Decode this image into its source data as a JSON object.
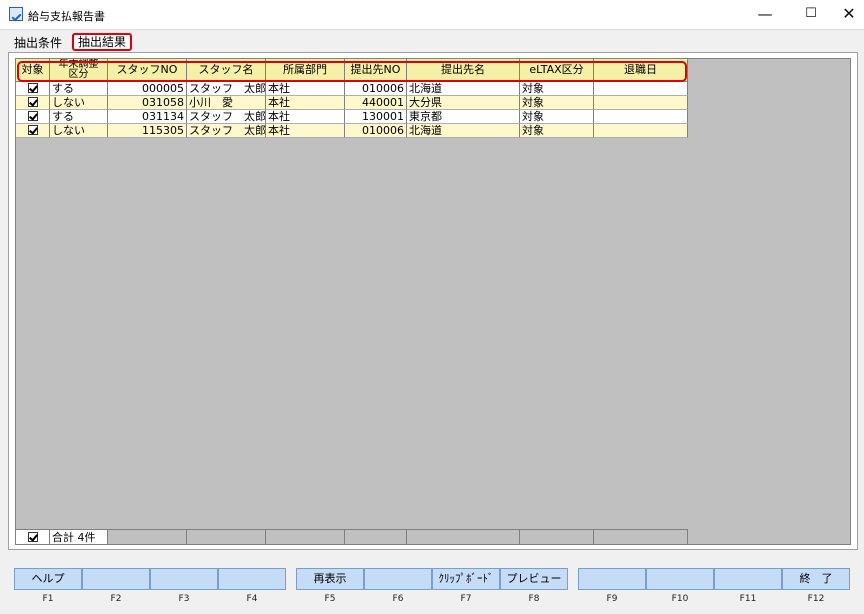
{
  "window": {
    "title": "給与支払報告書",
    "min": "—",
    "max": "☐",
    "close": "✕"
  },
  "tabs": [
    {
      "label": "抽出条件"
    },
    {
      "label": "抽出結果"
    }
  ],
  "table": {
    "headers": [
      "対象",
      "年末調整区分",
      "スタッフNO",
      "スタッフ名",
      "所属部門",
      "提出先NO",
      "提出先名",
      "eLTAX区分",
      "退職日"
    ],
    "header_year_line1": "年末調整",
    "header_year_line2": "区分",
    "rows": [
      {
        "checked": true,
        "year_adj": "する",
        "staff_no": "000005",
        "staff_name": "スタッフ　太郎",
        "dept": "本社",
        "dest_no": "010006",
        "dest_name": "北海道",
        "eltax": "対象",
        "retire": ""
      },
      {
        "checked": true,
        "year_adj": "しない",
        "staff_no": "031058",
        "staff_name": "小川　愛",
        "dept": "本社",
        "dest_no": "440001",
        "dest_name": "大分県",
        "eltax": "対象",
        "retire": ""
      },
      {
        "checked": true,
        "year_adj": "する",
        "staff_no": "031134",
        "staff_name": "スタッフ　太郎",
        "dept": "本社",
        "dest_no": "130001",
        "dest_name": "東京都",
        "eltax": "対象",
        "retire": ""
      },
      {
        "checked": true,
        "year_adj": "しない",
        "staff_no": "115305",
        "staff_name": "スタッフ　太郎",
        "dept": "本社",
        "dest_no": "010006",
        "dest_name": "北海道",
        "eltax": "対象",
        "retire": ""
      }
    ],
    "footer": {
      "checked": true,
      "total": "合計 4件"
    }
  },
  "fkeys": [
    {
      "label": "ヘルプ",
      "key": "F1"
    },
    {
      "label": "",
      "key": "F2"
    },
    {
      "label": "",
      "key": "F3"
    },
    {
      "label": "",
      "key": "F4"
    },
    {
      "label": "再表示",
      "key": "F5"
    },
    {
      "label": "",
      "key": "F6"
    },
    {
      "label": "ｸﾘｯﾌﾟﾎﾞｰﾄﾞ",
      "key": "F7"
    },
    {
      "label": "プレビュー",
      "key": "F8"
    },
    {
      "label": "",
      "key": "F9"
    },
    {
      "label": "",
      "key": "F10"
    },
    {
      "label": "",
      "key": "F11"
    },
    {
      "label": "終　了",
      "key": "F12"
    }
  ],
  "colors": {
    "row_alt": "#fdf9cc",
    "row_white": "#ffffff",
    "header_bg": "#f6efa6",
    "highlight": "#e0000b",
    "fkey_bg": "#c5dcf7"
  }
}
